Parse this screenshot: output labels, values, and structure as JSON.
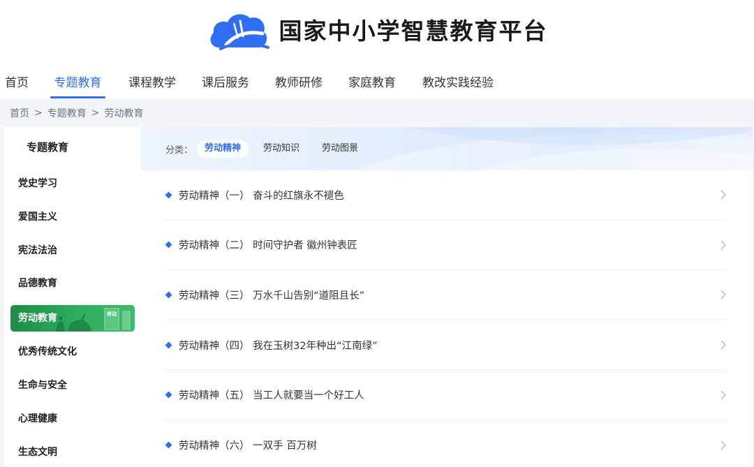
{
  "header": {
    "logo_text": "国家中小学智慧教育平台",
    "brand_color": "#2f6df3"
  },
  "topnav": {
    "items": [
      {
        "label": "首页"
      },
      {
        "label": "专题教育",
        "active": true
      },
      {
        "label": "课程教学"
      },
      {
        "label": "课后服务"
      },
      {
        "label": "教师研修"
      },
      {
        "label": "家庭教育"
      },
      {
        "label": "教改实践经验"
      }
    ]
  },
  "breadcrumb": {
    "items": [
      "首页",
      "专题教育",
      "劳动教育"
    ],
    "separator": ">"
  },
  "sidebar": {
    "title": "专题教育",
    "items": [
      {
        "label": "党史学习"
      },
      {
        "label": "爱国主义"
      },
      {
        "label": "宪法法治"
      },
      {
        "label": "品德教育"
      },
      {
        "label": "劳动教育",
        "active": true,
        "active_color": "#2fae5e",
        "book_text": "劳动"
      },
      {
        "label": "优秀传统文化"
      },
      {
        "label": "生命与安全"
      },
      {
        "label": "心理健康"
      },
      {
        "label": "生态文明"
      }
    ]
  },
  "filter": {
    "label": "分类：",
    "chips": [
      {
        "label": "劳动精神",
        "active": true
      },
      {
        "label": "劳动知识"
      },
      {
        "label": "劳动图景"
      }
    ]
  },
  "list": {
    "items": [
      {
        "title": "劳动精神（一） 奋斗的红旗永不褪色"
      },
      {
        "title": "劳动精神（二） 时间守护者 徽州钟表匠"
      },
      {
        "title": "劳动精神（三） 万水千山告别“道阻且长”"
      },
      {
        "title": "劳动精神（四） 我在玉树32年种出“江南绿”"
      },
      {
        "title": "劳动精神（五） 当工人就要当一个好工人"
      },
      {
        "title": "劳动精神（六） 一双手 百万树"
      }
    ]
  }
}
